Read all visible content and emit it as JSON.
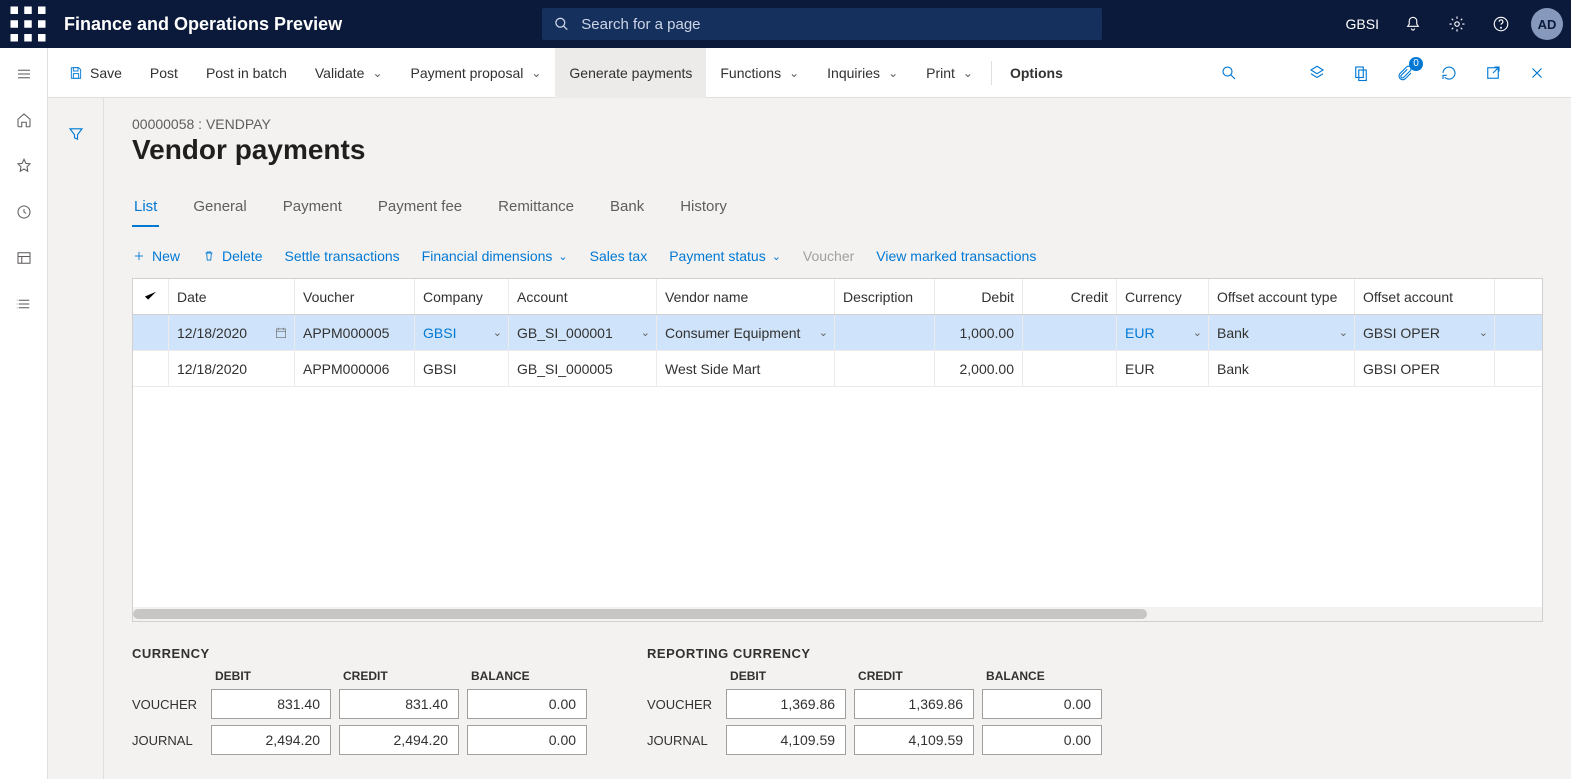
{
  "header": {
    "app_title": "Finance and Operations Preview",
    "search_placeholder": "Search for a page",
    "company": "GBSI",
    "avatar": "AD"
  },
  "actionbar": {
    "save": "Save",
    "post": "Post",
    "post_batch": "Post in batch",
    "validate": "Validate",
    "payment_proposal": "Payment proposal",
    "generate_payments": "Generate payments",
    "functions": "Functions",
    "inquiries": "Inquiries",
    "print": "Print",
    "options": "Options",
    "attach_badge": "0"
  },
  "page": {
    "breadcrumb": "00000058 : VENDPAY",
    "title": "Vendor payments"
  },
  "tabs": {
    "list": "List",
    "general": "General",
    "payment": "Payment",
    "payment_fee": "Payment fee",
    "remittance": "Remittance",
    "bank": "Bank",
    "history": "History"
  },
  "toolbar2": {
    "new": "New",
    "delete": "Delete",
    "settle": "Settle transactions",
    "fin_dim": "Financial dimensions",
    "sales_tax": "Sales tax",
    "payment_status": "Payment status",
    "voucher": "Voucher",
    "view_marked": "View marked transactions"
  },
  "grid": {
    "headers": {
      "date": "Date",
      "voucher": "Voucher",
      "company": "Company",
      "account": "Account",
      "vendor": "Vendor name",
      "desc": "Description",
      "debit": "Debit",
      "credit": "Credit",
      "currency": "Currency",
      "offset_type": "Offset account type",
      "offset_acct": "Offset account"
    },
    "rows": [
      {
        "date": "12/18/2020",
        "voucher": "APPM000005",
        "company": "GBSI",
        "account": "GB_SI_000001",
        "vendor": "Consumer Equipment",
        "desc": "",
        "debit": "1,000.00",
        "credit": "",
        "currency": "EUR",
        "offset_type": "Bank",
        "offset_acct": "GBSI OPER"
      },
      {
        "date": "12/18/2020",
        "voucher": "APPM000006",
        "company": "GBSI",
        "account": "GB_SI_000005",
        "vendor": "West Side Mart",
        "desc": "",
        "debit": "2,000.00",
        "credit": "",
        "currency": "EUR",
        "offset_type": "Bank",
        "offset_acct": "GBSI OPER"
      }
    ]
  },
  "totals": {
    "currency_title": "CURRENCY",
    "reporting_title": "REPORTING CURRENCY",
    "col_debit": "DEBIT",
    "col_credit": "CREDIT",
    "col_balance": "BALANCE",
    "row_voucher": "VOUCHER",
    "row_journal": "JOURNAL",
    "currency": {
      "voucher": {
        "debit": "831.40",
        "credit": "831.40",
        "balance": "0.00"
      },
      "journal": {
        "debit": "2,494.20",
        "credit": "2,494.20",
        "balance": "0.00"
      }
    },
    "reporting": {
      "voucher": {
        "debit": "1,369.86",
        "credit": "1,369.86",
        "balance": "0.00"
      },
      "journal": {
        "debit": "4,109.59",
        "credit": "4,109.59",
        "balance": "0.00"
      }
    }
  }
}
